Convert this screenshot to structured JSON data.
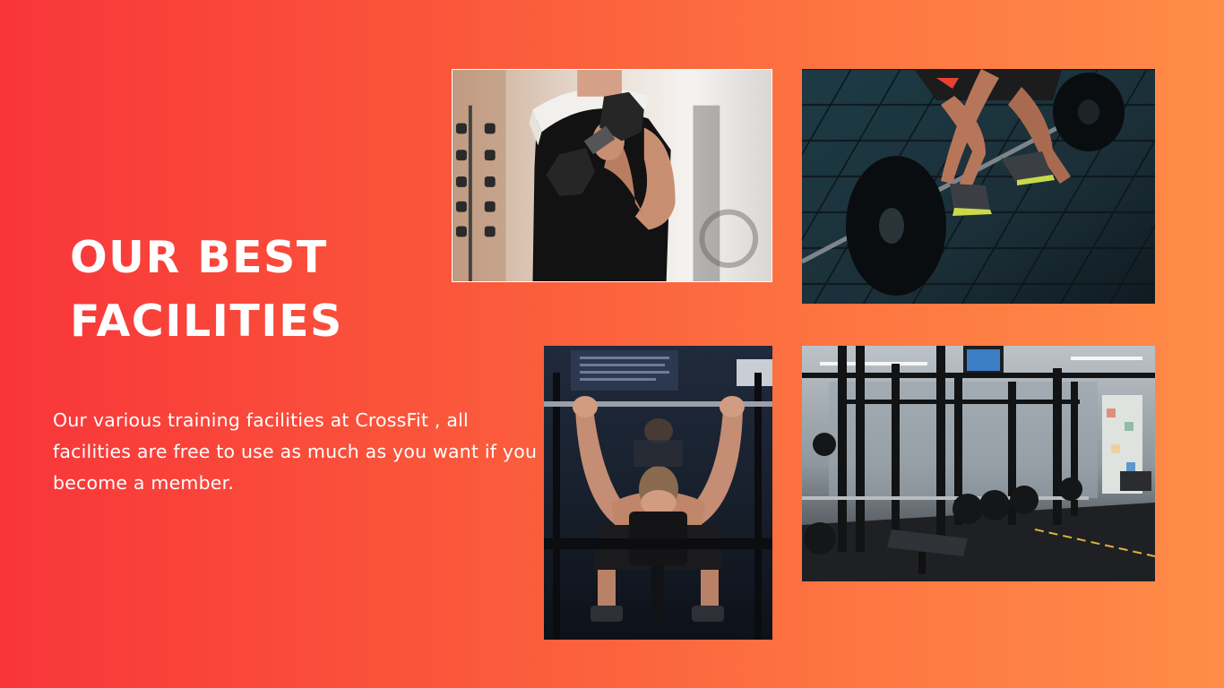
{
  "slide": {
    "title_lines": [
      "OUR BEST",
      "FACILITIES"
    ],
    "description": "Our various training facilities at CrossFit , all facilities are free to use as much as you want if you become a member.",
    "colors": {
      "gradient_start": "#f8353a",
      "gradient_end": "#ff8c48",
      "text": "#ffffff"
    }
  },
  "photos": [
    {
      "subject": "man-dumbbell-curl-photo"
    },
    {
      "subject": "barbell-deadlift-photo"
    },
    {
      "subject": "bench-press-photo"
    },
    {
      "subject": "gym-power-racks-photo"
    }
  ]
}
